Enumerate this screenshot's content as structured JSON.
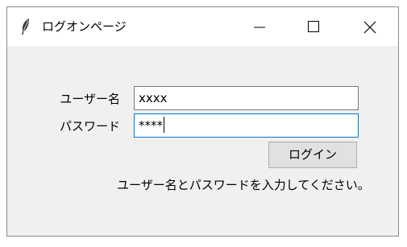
{
  "window": {
    "title": "ログオンページ",
    "icon": "feather-icon"
  },
  "form": {
    "username_label": "ユーザー名",
    "username_value": "xxxx",
    "password_label": "パスワード",
    "password_value": "****",
    "login_button": "ログイン",
    "message": "ユーザー名とパスワードを入力してください。"
  },
  "colors": {
    "focus_border": "#0078d7",
    "button_bg": "#e1e1e1",
    "client_bg": "#f0f0f0"
  }
}
